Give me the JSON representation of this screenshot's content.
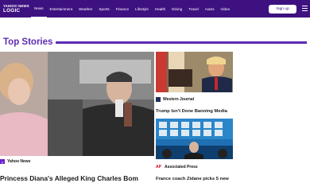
{
  "header": {
    "logo_line1": "YAHOO! NEWS",
    "logo_line2": "LOGIC",
    "nav": [
      "News",
      "Entertainment",
      "Weather",
      "Sports",
      "Finance",
      "Lifestyle",
      "Health",
      "Dining",
      "Travel",
      "Autos",
      "Video"
    ],
    "active_nav": "News",
    "signup_label": "Sign up",
    "brand_color": "#3d1280"
  },
  "section": {
    "title": "Top Stories",
    "accent_color": "#5d2bb6"
  },
  "hero": {
    "source": "Yahoo News",
    "title": "Princess Diana's Alleged King Charles Bom"
  },
  "cards": [
    {
      "source": "Western Journal",
      "title": "Trump Isn't Done Banning Media"
    },
    {
      "source": "Associated Press",
      "source_logo": "AP",
      "title": "France coach Zidane picks 5 new"
    }
  ]
}
